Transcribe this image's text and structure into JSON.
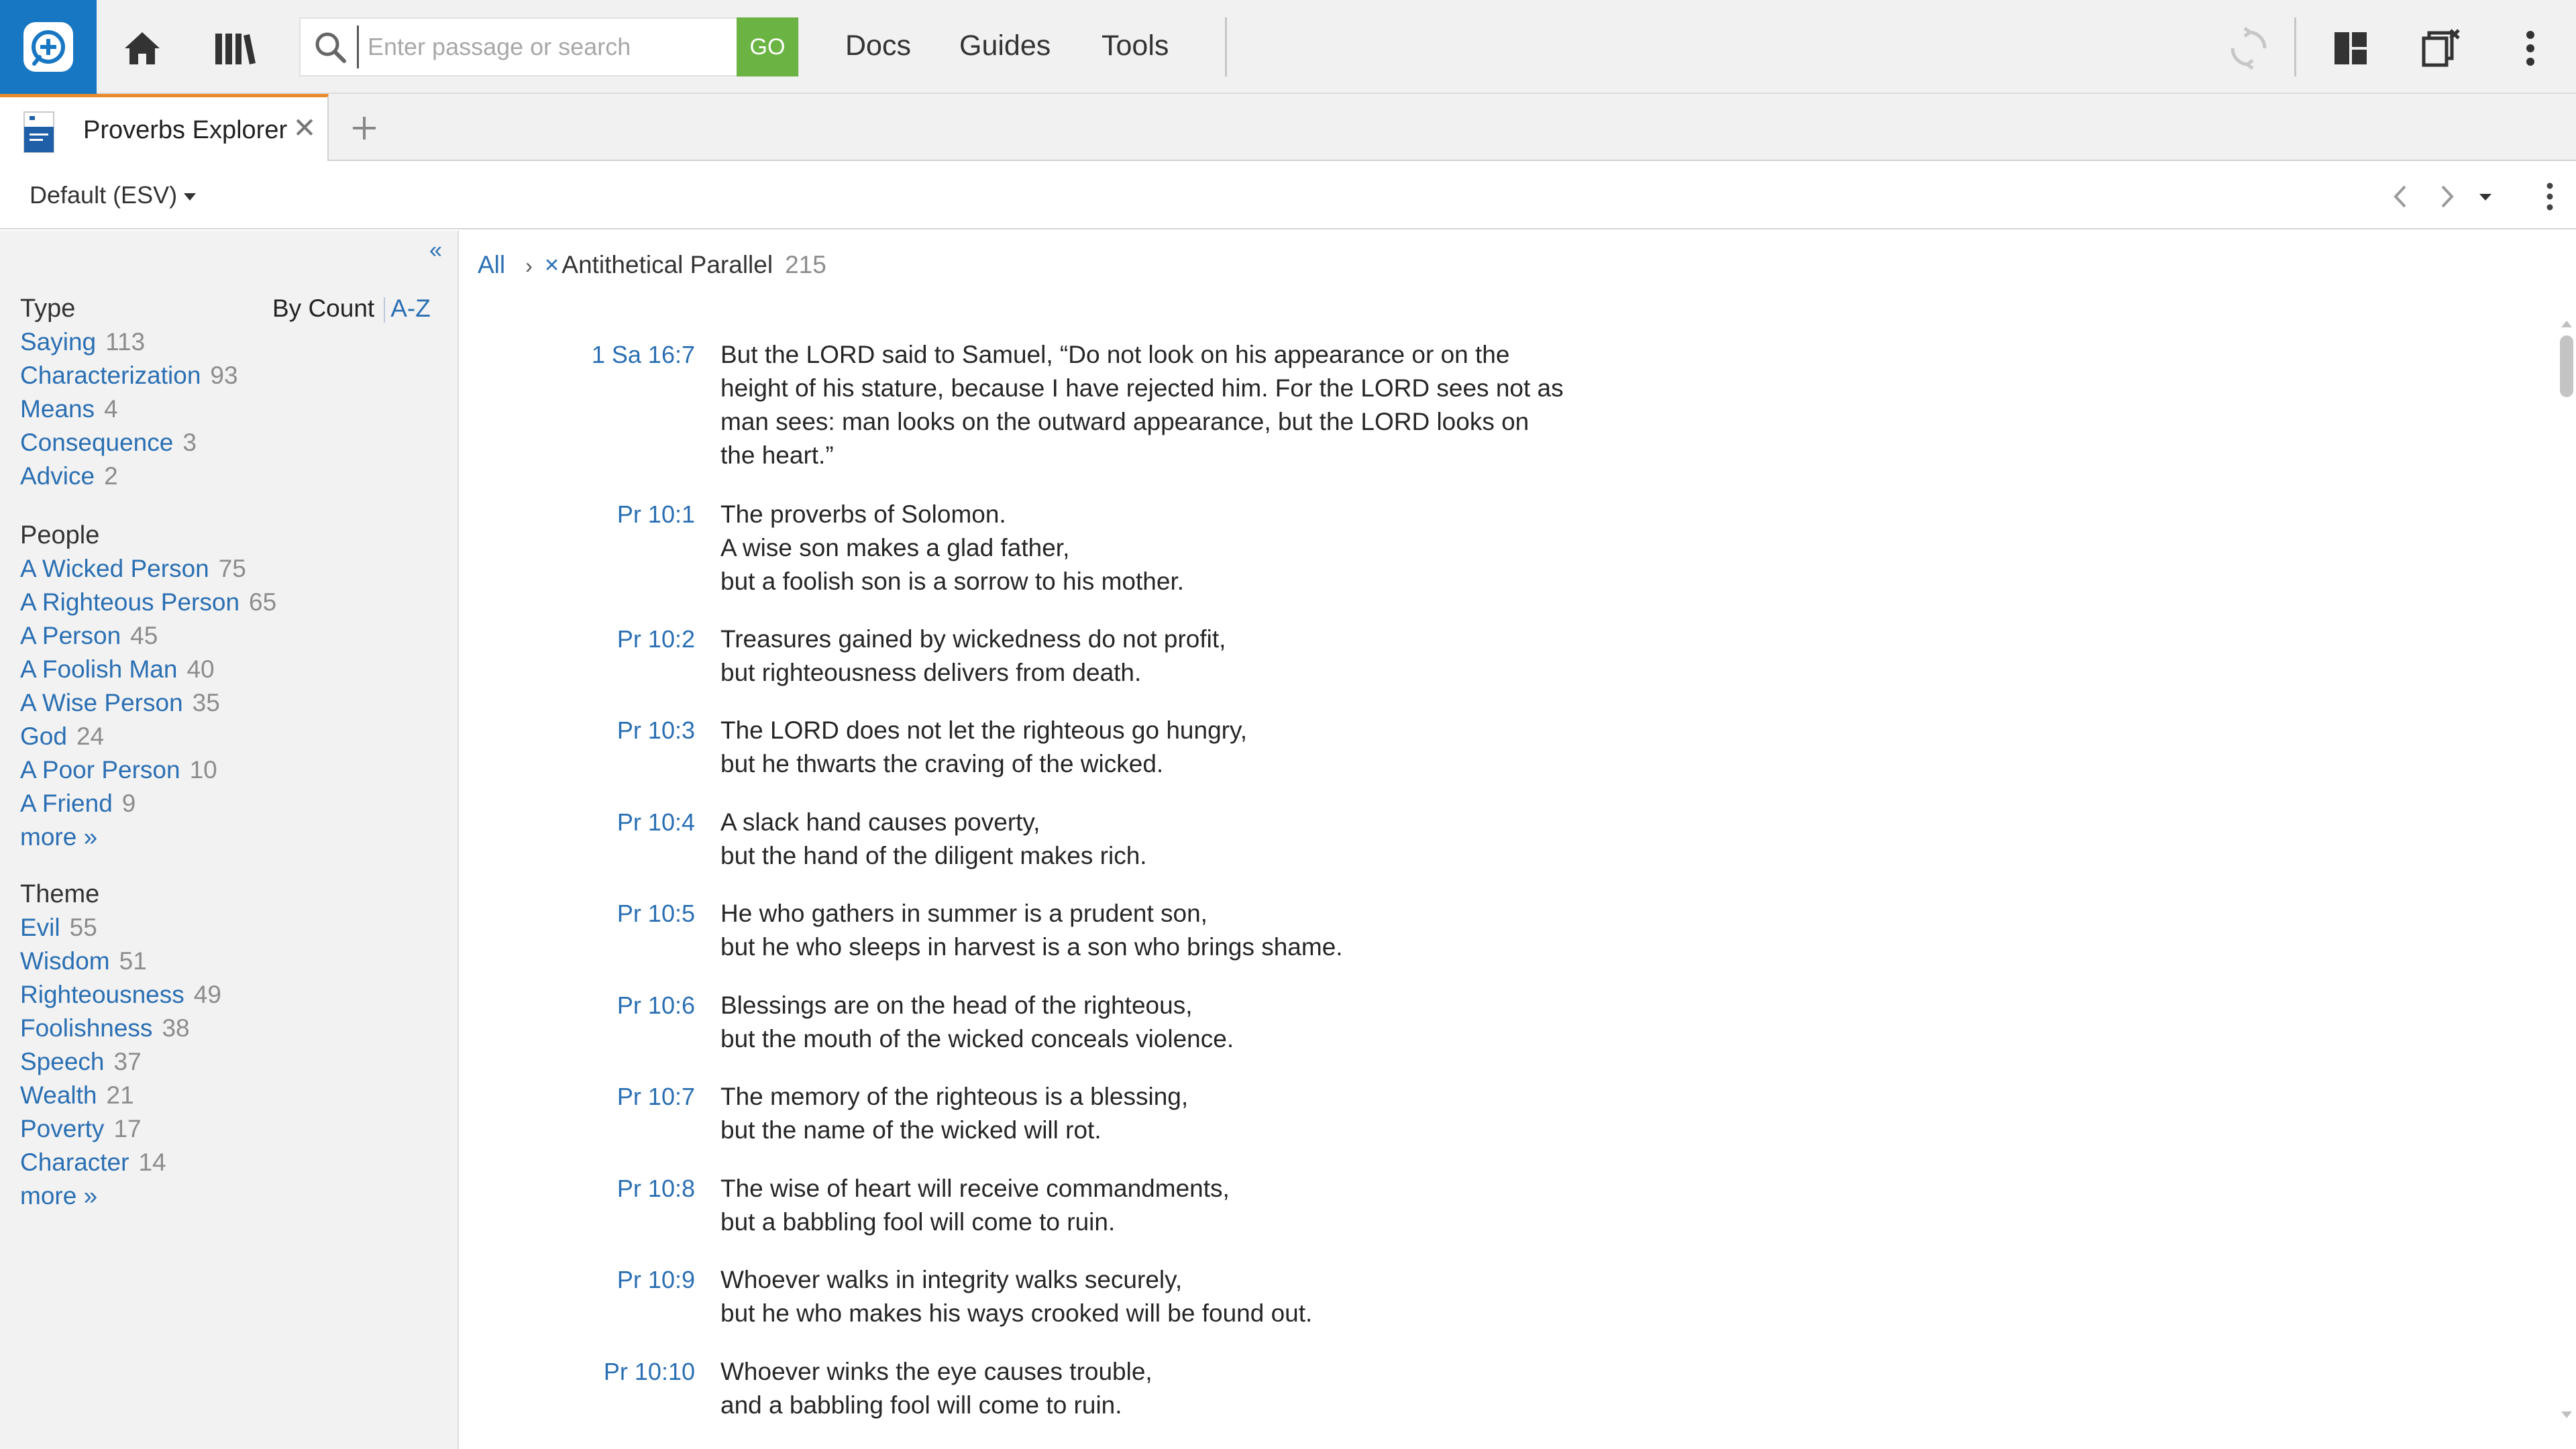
{
  "header": {
    "logo_icon": "logos-bible-icon",
    "home_icon": "home-icon",
    "library_icon": "library-icon",
    "search": {
      "placeholder": "Enter passage or search",
      "value": "",
      "go_label": "GO"
    },
    "nav": [
      "Docs",
      "Guides",
      "Tools"
    ],
    "right_icons": [
      "sync-icon",
      "layout-icon",
      "close-panels-icon",
      "more-vertical-icon"
    ],
    "accent_color": "#1877c3",
    "go_color": "#6bb443"
  },
  "tab": {
    "label": "Proverbs Explorer",
    "close": "✕",
    "active_color": "#e88a2e"
  },
  "panel": {
    "dataset": "Default (ESV)"
  },
  "sidebar": {
    "collapse": "«",
    "sort": {
      "by_count": "By Count",
      "az": "A-Z"
    },
    "groups": [
      {
        "title": "Type",
        "items": [
          {
            "label": "Saying",
            "count": "113"
          },
          {
            "label": "Characterization",
            "count": "93"
          },
          {
            "label": "Means",
            "count": "4"
          },
          {
            "label": "Consequence",
            "count": "3"
          },
          {
            "label": "Advice",
            "count": "2"
          }
        ]
      },
      {
        "title": "People",
        "items": [
          {
            "label": "A Wicked Person",
            "count": "75"
          },
          {
            "label": "A Righteous Person",
            "count": "65"
          },
          {
            "label": "A Person",
            "count": "45"
          },
          {
            "label": "A Foolish Man",
            "count": "40"
          },
          {
            "label": "A Wise Person",
            "count": "35"
          },
          {
            "label": "God",
            "count": "24"
          },
          {
            "label": "A Poor Person",
            "count": "10"
          },
          {
            "label": "A Friend",
            "count": "9"
          }
        ],
        "more": "more »"
      },
      {
        "title": "Theme",
        "items": [
          {
            "label": "Evil",
            "count": "55"
          },
          {
            "label": "Wisdom",
            "count": "51"
          },
          {
            "label": "Righteousness",
            "count": "49"
          },
          {
            "label": "Foolishness",
            "count": "38"
          },
          {
            "label": "Speech",
            "count": "37"
          },
          {
            "label": "Wealth",
            "count": "21"
          },
          {
            "label": "Poverty",
            "count": "17"
          },
          {
            "label": "Character",
            "count": "14"
          }
        ],
        "more": "more »"
      }
    ]
  },
  "breadcrumb": {
    "all": "All",
    "chevron": "›",
    "remove": "×",
    "filter": "Antithetical Parallel",
    "count": "215"
  },
  "verses": [
    {
      "ref": "1 Sa 16:7",
      "lines": [
        "But the LORD said to Samuel, “Do not look on his appearance or on the",
        "height of his stature, because I have rejected him. For the LORD sees not as",
        "man sees: man looks on the outward appearance, but the LORD looks on",
        "the heart.”"
      ]
    },
    {
      "ref": "Pr 10:1",
      "lines": [
        "The proverbs of Solomon.",
        "A wise son makes a glad father,",
        "but a foolish son is a sorrow to his mother."
      ]
    },
    {
      "ref": "Pr 10:2",
      "lines": [
        "Treasures gained by wickedness do not profit,",
        "but righteousness delivers from death."
      ]
    },
    {
      "ref": "Pr 10:3",
      "lines": [
        "The LORD does not let the righteous go hungry,",
        "but he thwarts the craving of the wicked."
      ]
    },
    {
      "ref": "Pr 10:4",
      "lines": [
        "A slack hand causes poverty,",
        "but the hand of the diligent makes rich."
      ]
    },
    {
      "ref": "Pr 10:5",
      "lines": [
        "He who gathers in summer is a prudent son,",
        "but he who sleeps in harvest is a son who brings shame."
      ]
    },
    {
      "ref": "Pr 10:6",
      "lines": [
        "Blessings are on the head of the righteous,",
        "but the mouth of the wicked conceals violence."
      ]
    },
    {
      "ref": "Pr 10:7",
      "lines": [
        "The memory of the righteous is a blessing,",
        "but the name of the wicked will rot."
      ]
    },
    {
      "ref": "Pr 10:8",
      "lines": [
        "The wise of heart will receive commandments,",
        "but a babbling fool will come to ruin."
      ]
    },
    {
      "ref": "Pr 10:9",
      "lines": [
        "Whoever walks in integrity walks securely,",
        "but he who makes his ways crooked will be found out."
      ]
    },
    {
      "ref": "Pr 10:10",
      "lines": [
        "Whoever winks the eye causes trouble,",
        "and a babbling fool will come to ruin."
      ]
    }
  ]
}
